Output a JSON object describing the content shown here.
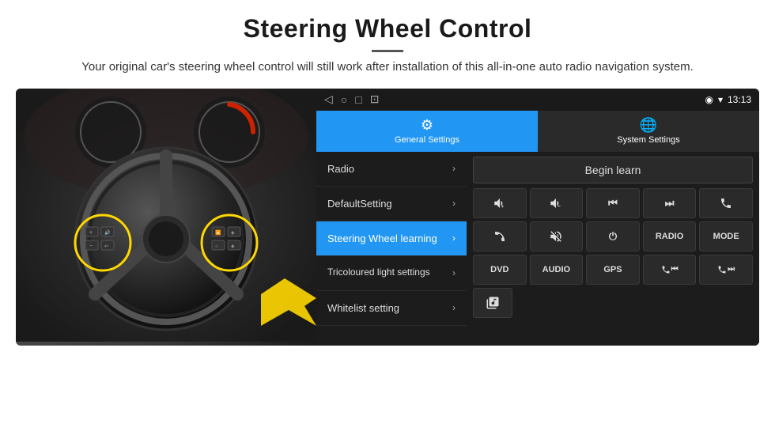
{
  "header": {
    "title": "Steering Wheel Control",
    "subtitle": "Your original car's steering wheel control will still work after installation of this all-in-one auto radio navigation system."
  },
  "statusBar": {
    "time": "13:13",
    "navIcons": [
      "◁",
      "○",
      "□",
      "⊡"
    ]
  },
  "tabs": [
    {
      "id": "general",
      "label": "General Settings",
      "active": true
    },
    {
      "id": "system",
      "label": "System Settings",
      "active": false
    }
  ],
  "menuItems": [
    {
      "id": "radio",
      "label": "Radio",
      "active": false
    },
    {
      "id": "default",
      "label": "DefaultSetting",
      "active": false
    },
    {
      "id": "steering",
      "label": "Steering Wheel learning",
      "active": true
    },
    {
      "id": "tricoloured",
      "label": "Tricoloured light settings",
      "active": false
    },
    {
      "id": "whitelist",
      "label": "Whitelist setting",
      "active": false
    }
  ],
  "beginLearnBtn": "Begin learn",
  "controlRows": [
    [
      {
        "id": "vol-up",
        "label": "🔊+"
      },
      {
        "id": "vol-down",
        "label": "🔉−"
      },
      {
        "id": "prev-track",
        "label": "⏮"
      },
      {
        "id": "next-track",
        "label": "⏭"
      },
      {
        "id": "phone",
        "label": "📞"
      }
    ],
    [
      {
        "id": "hook",
        "label": "↩"
      },
      {
        "id": "mute",
        "label": "🔇×"
      },
      {
        "id": "power",
        "label": "⏻"
      },
      {
        "id": "radio-btn",
        "label": "RADIO"
      },
      {
        "id": "mode-btn",
        "label": "MODE"
      }
    ],
    [
      {
        "id": "dvd-btn",
        "label": "DVD"
      },
      {
        "id": "audio-btn",
        "label": "AUDIO"
      },
      {
        "id": "gps-btn",
        "label": "GPS"
      },
      {
        "id": "phone-prev",
        "label": "📞⏮"
      },
      {
        "id": "phone-next",
        "label": "📞⏭"
      }
    ],
    [
      {
        "id": "extra1",
        "label": "🎵"
      }
    ]
  ]
}
